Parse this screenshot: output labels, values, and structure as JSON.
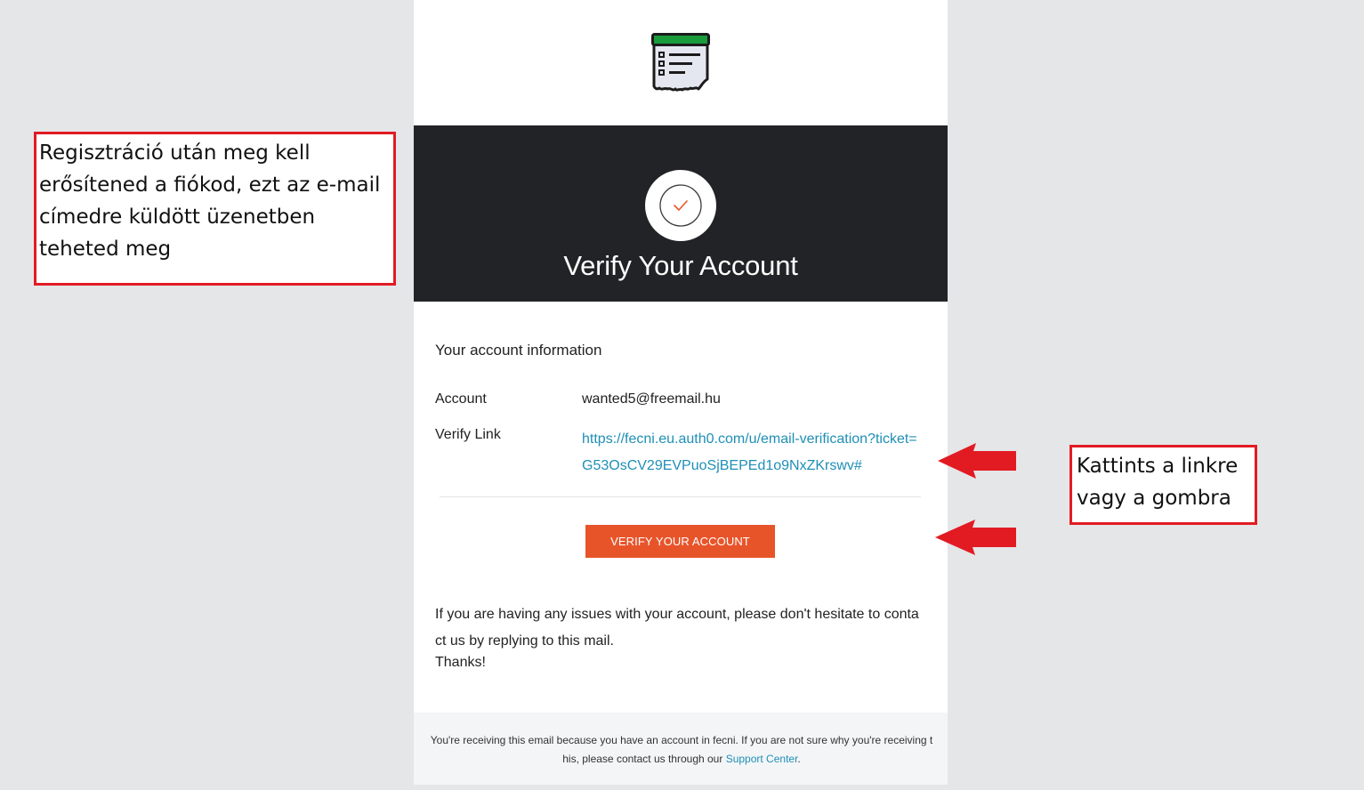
{
  "email": {
    "logo_icon": "receipt-list-icon",
    "hero": {
      "check_icon": "checkmark-icon",
      "title": "Verify Your Account"
    },
    "section_heading": "Your account information",
    "account_label": "Account",
    "account_value": "wanted5@freemail.hu",
    "verify_link_label": "Verify Link",
    "verify_link_url": "https://fecni.eu.auth0.com/u/email-verification?ticket=G53OsCV29EVPuoSjBEPEd1o9NxZKrswv#",
    "verify_button_label": "VERIFY YOUR ACCOUNT",
    "support_text": "If you are having any issues with your account, please don't hesitate to contact us by replying to this mail.",
    "thanks": "Thanks!",
    "footer": {
      "text_before": "You're receiving this email because you have an account in fecni. If you are not sure why you're receiving this, please contact us through our ",
      "link_text": "Support Center",
      "text_after": "."
    }
  },
  "annotations": {
    "left_note": "Regisztráció után meg kell erősítened a fiókod, ezt az e-mail címedre küldött üzenetben teheted meg",
    "right_note": "Kattints a linkre vagy a gombra",
    "arrow_color": "#e21b23"
  },
  "colors": {
    "hero_background": "#222326",
    "button_background": "#e8542a",
    "link_color": "#1f8fb5",
    "logo_green": "#1a9b3c",
    "page_background": "#e5e6e8"
  }
}
